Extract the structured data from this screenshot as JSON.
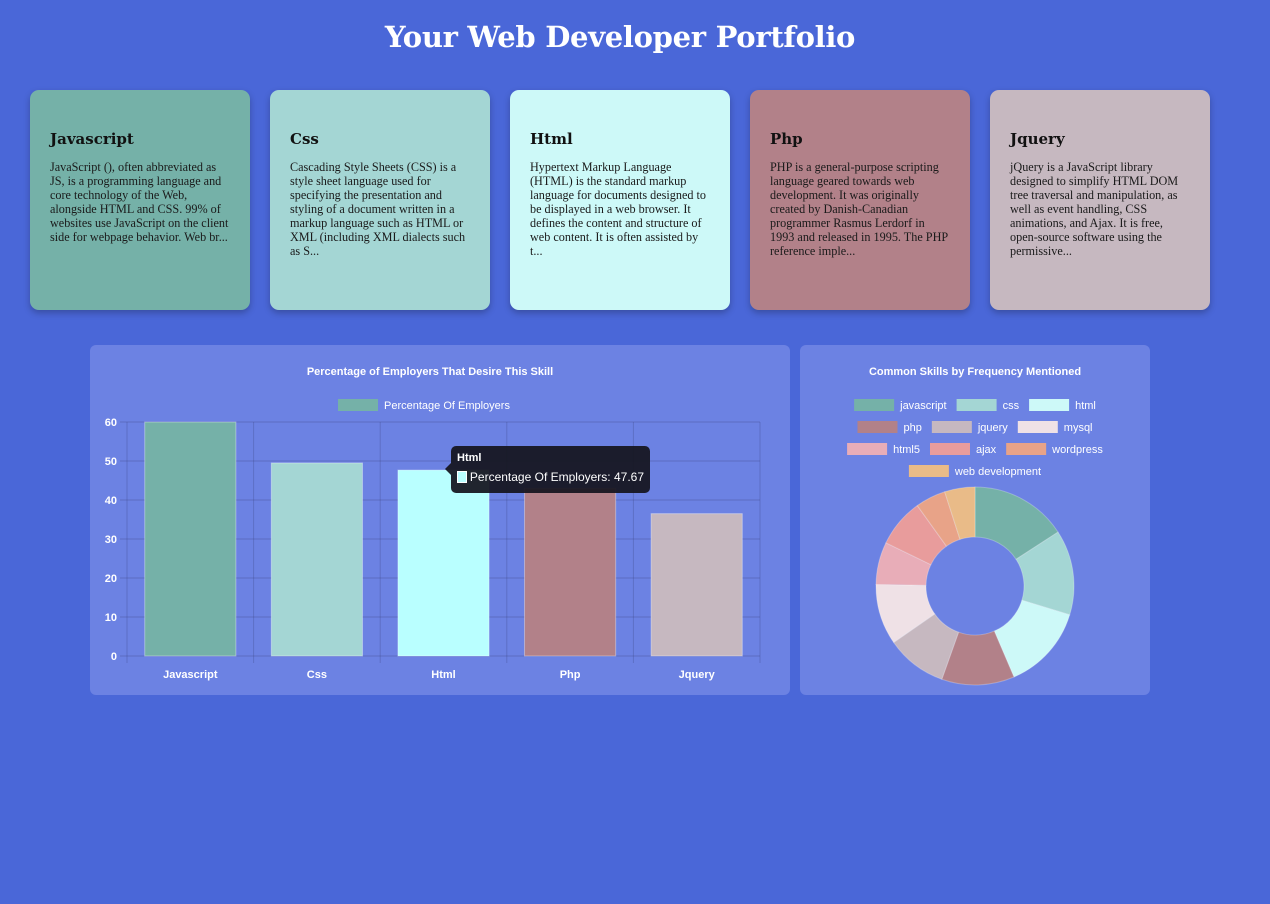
{
  "page": {
    "title": "Your Web Developer Portfolio"
  },
  "cards": [
    {
      "title": "Javascript",
      "text": "JavaScript (), often abbreviated as JS, is a programming language and core technology of the Web, alongside HTML and CSS. 99% of websites use JavaScript on the client side for webpage behavior. Web br...",
      "color": "#75b1a8"
    },
    {
      "title": "Css",
      "text": "Cascading Style Sheets (CSS) is a style sheet language used for specifying the presentation and styling of a document written in a markup language such as HTML or XML (including XML dialects such as S...",
      "color": "#a4d6d4"
    },
    {
      "title": "Html",
      "text": "Hypertext Markup Language (HTML) is the standard markup language for documents designed to be displayed in a web browser. It defines the content and structure of web content. It is often assisted by t...",
      "color": "#cdf9f8"
    },
    {
      "title": "Php",
      "text": "PHP is a general-purpose scripting language geared towards web development. It was originally created by Danish-Canadian programmer Rasmus Lerdorf in 1993 and released in 1995. The PHP reference imple...",
      "color": "#b28189"
    },
    {
      "title": "Jquery",
      "text": "jQuery is a JavaScript library designed to simplify HTML DOM tree traversal and manipulation, as well as event handling, CSS animations, and Ajax. It is free, open-source software using the permissive...",
      "color": "#c6b8c0"
    }
  ],
  "tooltip": {
    "title": "Html",
    "label": "Percentage Of Employers: 47.67"
  },
  "chart_data": [
    {
      "type": "bar",
      "title": "Percentage of Employers That Desire This Skill",
      "categories": [
        "Javascript",
        "Css",
        "Html",
        "Php",
        "Jquery"
      ],
      "series": [
        {
          "name": "Percentage Of Employers",
          "values": [
            60,
            49.5,
            47.67,
            43,
            36.5
          ]
        }
      ],
      "colors": [
        "#75b1a8",
        "#a4d6d4",
        "#b9ffff",
        "#b28189",
        "#c6b8c0"
      ],
      "legend_color": "#75b1a8",
      "ylim": [
        0,
        60
      ],
      "yticks": [
        0,
        10,
        20,
        30,
        40,
        50,
        60
      ],
      "xlabel": "",
      "ylabel": "",
      "grid": true,
      "legend": "top"
    },
    {
      "type": "pie",
      "title": "Common Skills by Frequency Mentioned",
      "labels": [
        "javascript",
        "css",
        "html",
        "php",
        "jquery",
        "mysql",
        "html5",
        "ajax",
        "wordpress",
        "web development"
      ],
      "values": [
        16,
        14,
        14,
        12,
        10,
        10,
        7,
        8,
        5,
        5
      ],
      "colors": [
        "#75b1a8",
        "#a4d6d4",
        "#cdf9f8",
        "#b28189",
        "#c6b8c0",
        "#efe1e6",
        "#e8adb8",
        "#e89c9c",
        "#e8a388",
        "#e9bb88"
      ],
      "donut": true,
      "legend": "top"
    }
  ]
}
